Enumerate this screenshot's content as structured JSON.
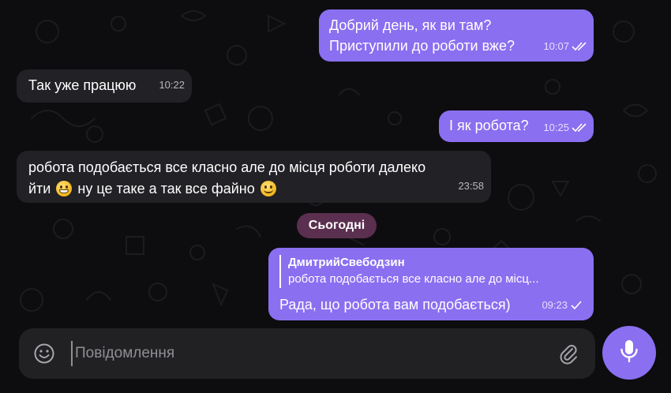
{
  "messages": [
    {
      "lines": [
        "Добрий день, як ви там?",
        "Приступили до роботи вже?"
      ],
      "time": "10:07",
      "read": true
    },
    {
      "text": "Так уже працюю",
      "time": "10:22"
    },
    {
      "text": "І як робота?",
      "time": "10:25",
      "read": true
    },
    {
      "line1": "робота подобається все класно але до місця роботи далеко",
      "line2a": "йти",
      "line2b": "ну це таке а так все файно",
      "time": "23:58"
    }
  ],
  "date_separator": "Сьогодні",
  "reply_message": {
    "quoted_author": "ДмитрийСвебодзин",
    "quoted_text": "робота подобається все класно але до місц...",
    "text": "Рада, що робота вам подобається)",
    "time": "09:23"
  },
  "composer": {
    "placeholder": "Повідомлення"
  },
  "icons": {
    "emoji_button": "smile-icon",
    "attach": "paperclip-icon",
    "send": "microphone-icon",
    "status_read": "double-check-icon",
    "status_sent": "check-icon"
  },
  "colors": {
    "accent": "#8a6ff0",
    "incoming_bubble": "#222125",
    "date_pill": "#5b2f4f",
    "background": "#0d0d10"
  }
}
